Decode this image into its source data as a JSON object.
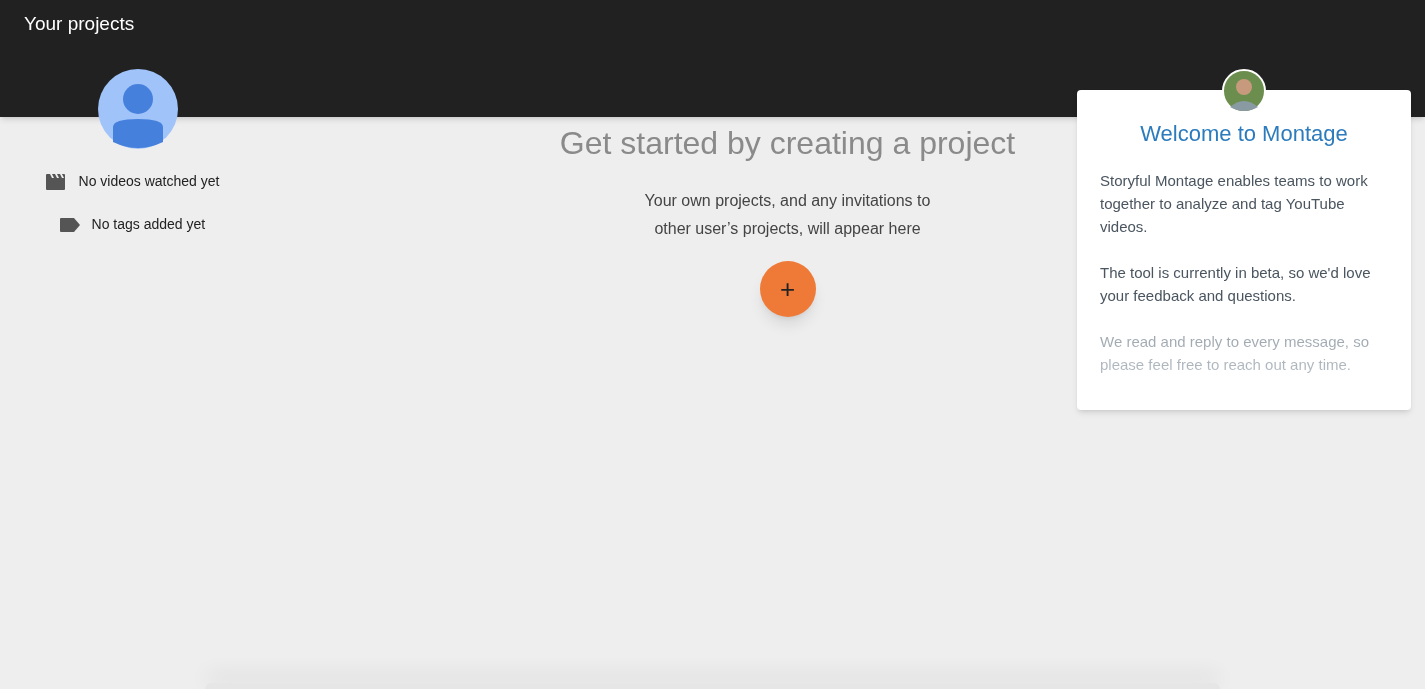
{
  "header": {
    "title": "Your projects"
  },
  "profile": {
    "stats": [
      {
        "kind": "videos",
        "text": "No videos watched yet"
      },
      {
        "kind": "tags",
        "text": "No tags added yet"
      }
    ]
  },
  "main": {
    "heading": "Get started by creating a project",
    "description": "Your own projects, and any invitations to other user’s projects, will appear here",
    "add_button": "+"
  },
  "welcome": {
    "title": "Welcome to Montage",
    "paragraphs": [
      {
        "text": "Storyful Montage enables teams to work together to analyze and tag YouTube videos.",
        "faded": false
      },
      {
        "text": "The tool is currently in beta, so we'd love your feedback and questions.",
        "faded": false
      },
      {
        "text": "We read and reply to every message, so please feel free to reach out any time.",
        "faded": true
      }
    ]
  }
}
